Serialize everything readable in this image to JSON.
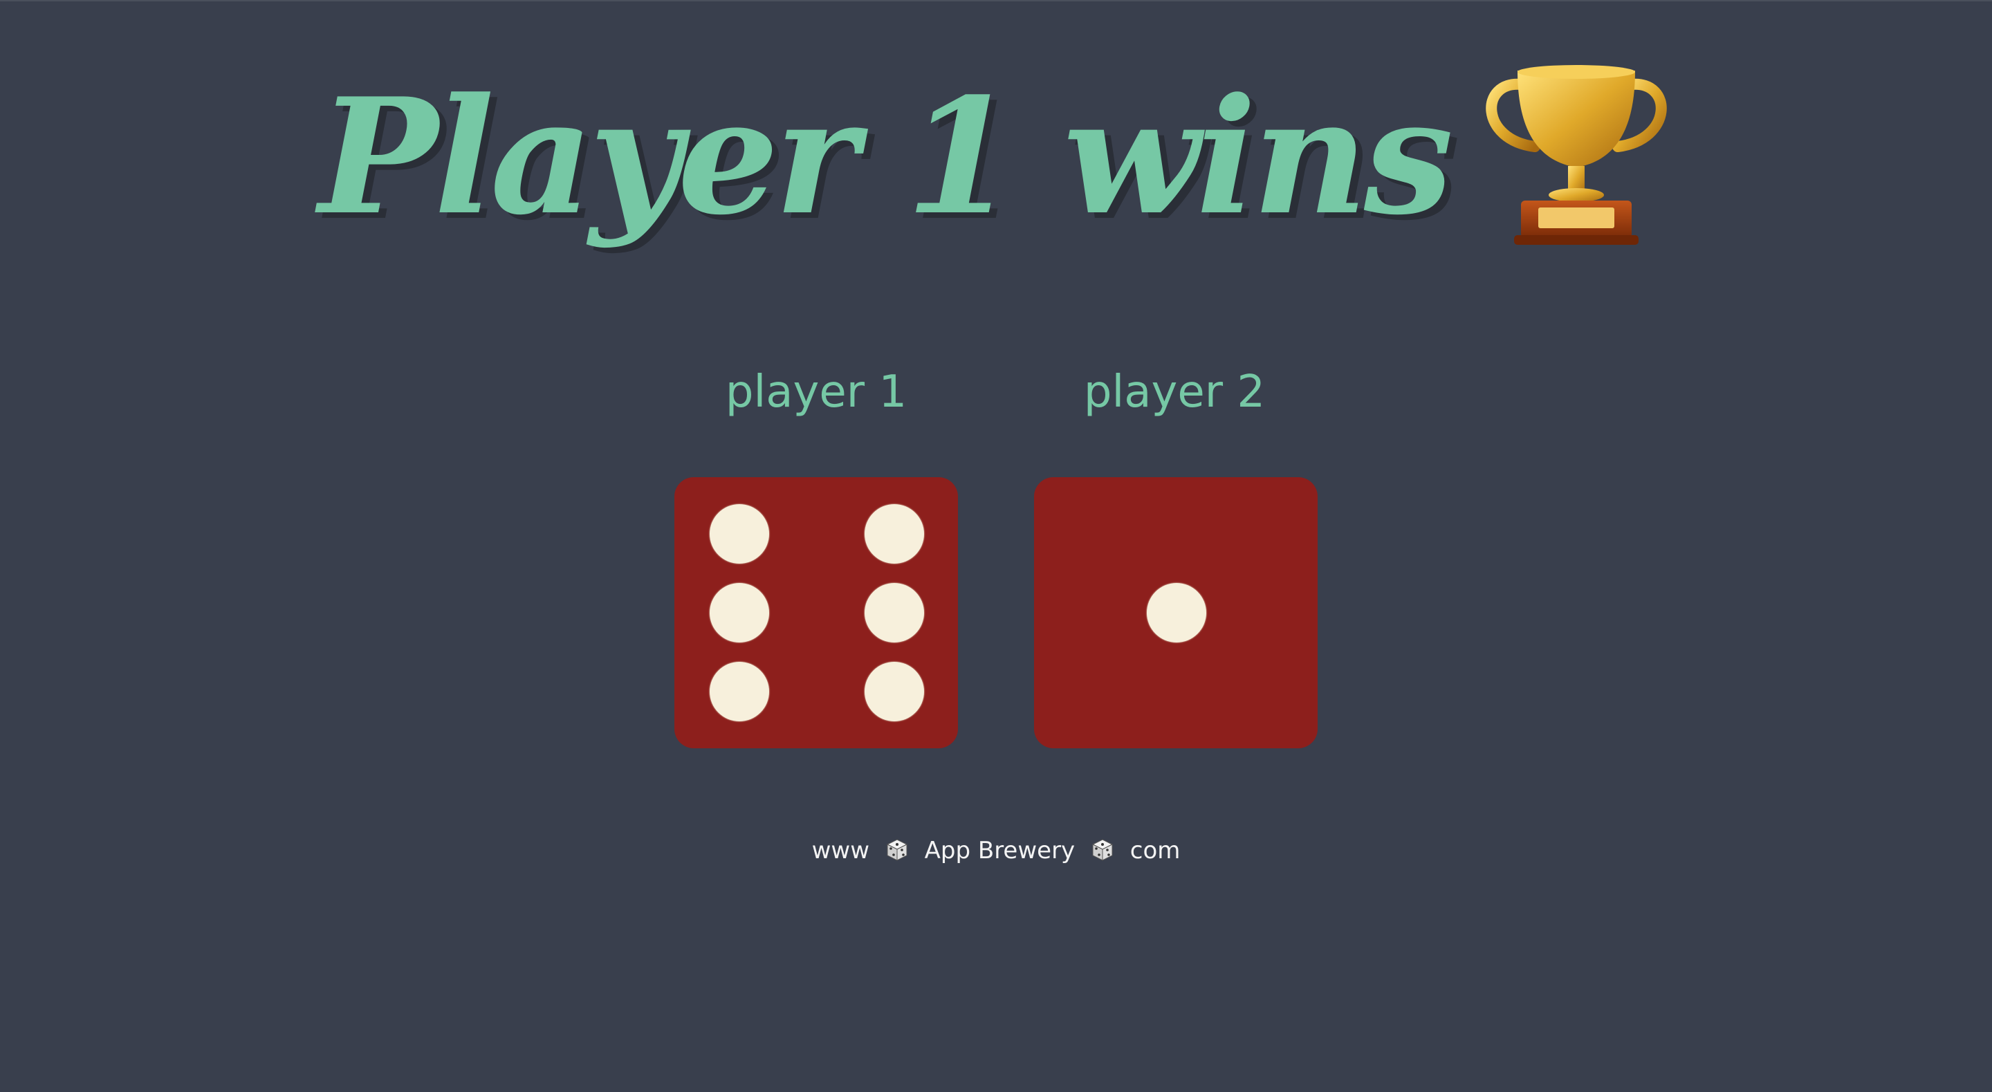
{
  "title": "Player 1 wins",
  "trophy_icon": "trophy-icon",
  "players": [
    {
      "label": "player 1",
      "die_value": 6
    },
    {
      "label": "player 2",
      "die_value": 1
    }
  ],
  "footer": {
    "part1": "www",
    "part2": "App Brewery",
    "part3": "com",
    "separator_icon": "dice-icon"
  },
  "colors": {
    "background": "#393f4d",
    "accent": "#76c8a5",
    "die": "#8d1f1c",
    "pip": "#f7f0dc"
  }
}
